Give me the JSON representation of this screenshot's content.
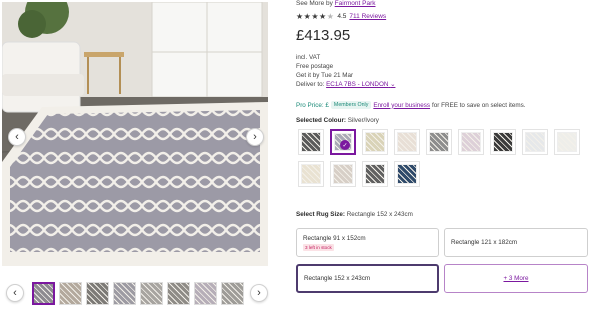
{
  "gallery": {
    "hero_alt": "Silver/Ivory trellis pattern rectangle rug in living room",
    "prev_icon": "chevron-left-icon",
    "next_icon": "chevron-right-icon",
    "thumbnails": [
      {
        "label": "rug-view-1",
        "active": true
      },
      {
        "label": "rug-view-2",
        "active": false
      },
      {
        "label": "rug-view-3",
        "active": false
      },
      {
        "label": "rug-view-4",
        "active": false
      },
      {
        "label": "rug-view-5",
        "active": false
      },
      {
        "label": "rug-view-6",
        "active": false
      },
      {
        "label": "rug-view-7",
        "active": false
      },
      {
        "label": "rug-view-8",
        "active": false
      }
    ]
  },
  "product": {
    "see_more_prefix": "See More by",
    "brand": "Fairmont Park",
    "rating_value": "4.5",
    "reviews_text": "711 Reviews",
    "price": "£413.95",
    "vat": "incl. VAT",
    "postage": "Free postage",
    "delivery_by": "Get it by Tue 21 Mar",
    "deliver_to_prefix": "Deliver to:",
    "deliver_to_location": "EC1A 7BS - LONDON",
    "pro_price_label": "Pro Price: £",
    "members_badge": "Members Only",
    "enroll_link": "Enroll your business",
    "enroll_suffix": "for FREE to save on select items."
  },
  "colour": {
    "label": "Selected Colour:",
    "value": "Silver/Ivory",
    "swatches": [
      {
        "name": "charcoal-ivory",
        "color": "#5a5a5a",
        "selected": false
      },
      {
        "name": "silver-ivory",
        "color": "#a9a9b6",
        "selected": true
      },
      {
        "name": "beige-ivory",
        "color": "#d9d3b8",
        "selected": false
      },
      {
        "name": "ivory-beige",
        "color": "#e8dfd6",
        "selected": false
      },
      {
        "name": "grey-ivory",
        "color": "#8d8d8d",
        "selected": false
      },
      {
        "name": "ivory-lilac",
        "color": "#ddd0d8",
        "selected": false
      },
      {
        "name": "black-ivory",
        "color": "#3a3a3a",
        "selected": false
      },
      {
        "name": "light-grey",
        "color": "#e6e8ea",
        "selected": false
      },
      {
        "name": "ivory-silver",
        "color": "#eeeeea",
        "selected": false
      },
      {
        "name": "ivory-beige-2",
        "color": "#e9e2d2",
        "selected": false
      },
      {
        "name": "beige-taupe",
        "color": "#d7cfc7",
        "selected": false
      },
      {
        "name": "dark-grey",
        "color": "#606060",
        "selected": false
      },
      {
        "name": "navy-ivory",
        "color": "#2f4a6a",
        "selected": false
      }
    ]
  },
  "size": {
    "label": "Select Rug Size:",
    "value": "Rectangle 152 x 243cm",
    "options": [
      {
        "label": "Rectangle 91 x 152cm",
        "badge": "3 left in stock",
        "selected": false
      },
      {
        "label": "Rectangle 121 x 182cm",
        "badge": "",
        "selected": false
      },
      {
        "label": "Rectangle 152 x 243cm",
        "badge": "",
        "selected": true
      },
      {
        "label": "+ 3 More",
        "badge": "",
        "selected": false
      }
    ]
  },
  "colors": {
    "accent": "#7b189f",
    "pro_green": "#1b8a78",
    "stock_red": "#c2185b"
  }
}
